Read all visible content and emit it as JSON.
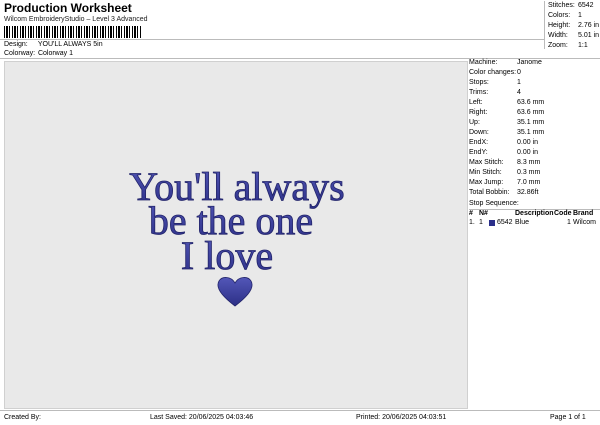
{
  "header": {
    "title": "Production Worksheet",
    "subtitle": "Wilcom EmbroideryStudio – Level 3 Advanced",
    "design_label": "Design:",
    "design_value": "YOU'LL ALWAYS 5in",
    "colorway_label": "Colorway:",
    "colorway_value": "Colorway 1"
  },
  "top_stats": [
    {
      "label": "Stitches:",
      "value": "6542"
    },
    {
      "label": "Colors:",
      "value": "1"
    },
    {
      "label": "Height:",
      "value": "2.76 in"
    },
    {
      "label": "Width:",
      "value": "5.01 in"
    },
    {
      "label": "Zoom:",
      "value": "1:1"
    }
  ],
  "design_text": {
    "line1": "You'll always",
    "line2": "be the one",
    "line3": "I love",
    "thread_color": "#3b3f9a"
  },
  "machine_stats": [
    {
      "label": "Machine:",
      "value": "Janome"
    },
    {
      "label": "Color changes:",
      "value": "0"
    },
    {
      "label": "Stops:",
      "value": "1"
    },
    {
      "label": "Trims:",
      "value": "4"
    },
    {
      "label": "Left:",
      "value": "63.6 mm"
    },
    {
      "label": "Right:",
      "value": "63.6 mm"
    },
    {
      "label": "Up:",
      "value": "35.1 mm"
    },
    {
      "label": "Down:",
      "value": "35.1 mm"
    },
    {
      "label": "EndX:",
      "value": "0.00 in"
    },
    {
      "label": "EndY:",
      "value": "0.00 in"
    },
    {
      "label": "Max Stitch:",
      "value": "8.3 mm"
    },
    {
      "label": "Min Stitch:",
      "value": "0.3 mm"
    },
    {
      "label": "Max Jump:",
      "value": "7.0 mm"
    },
    {
      "label": "Total Bobbin:",
      "value": "32.86ft"
    }
  ],
  "stop_sequence": {
    "label": "Stop Sequence:",
    "columns": [
      "#",
      "N#",
      "Description",
      "Code",
      "Brand"
    ],
    "rows": [
      {
        "num": "1.",
        "n": "1",
        "stitches": "6542",
        "description": "Blue",
        "code": "1",
        "brand": "Wilcom",
        "color": "#2b2f8a"
      }
    ]
  },
  "footer": {
    "created_by": "Created By:",
    "last_saved": "Last Saved: 20/06/2025 04:03:46",
    "printed": "Printed: 20/06/2025 04:03:51",
    "page": "Page 1 of 1"
  }
}
